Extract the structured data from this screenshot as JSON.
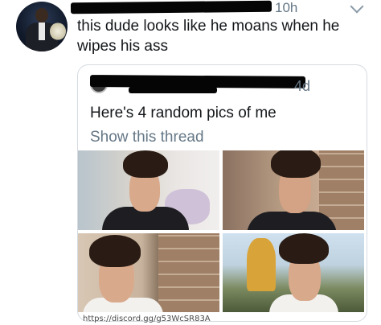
{
  "tweet": {
    "time": "10h",
    "text": "this dude looks like he moans when he wipes his ass"
  },
  "quoted_tweet": {
    "time": "4d",
    "text": "Here's 4 random pics of me",
    "show_thread": "Show this thread"
  },
  "watermark": "https://discord.gg/g53WcSR83A"
}
